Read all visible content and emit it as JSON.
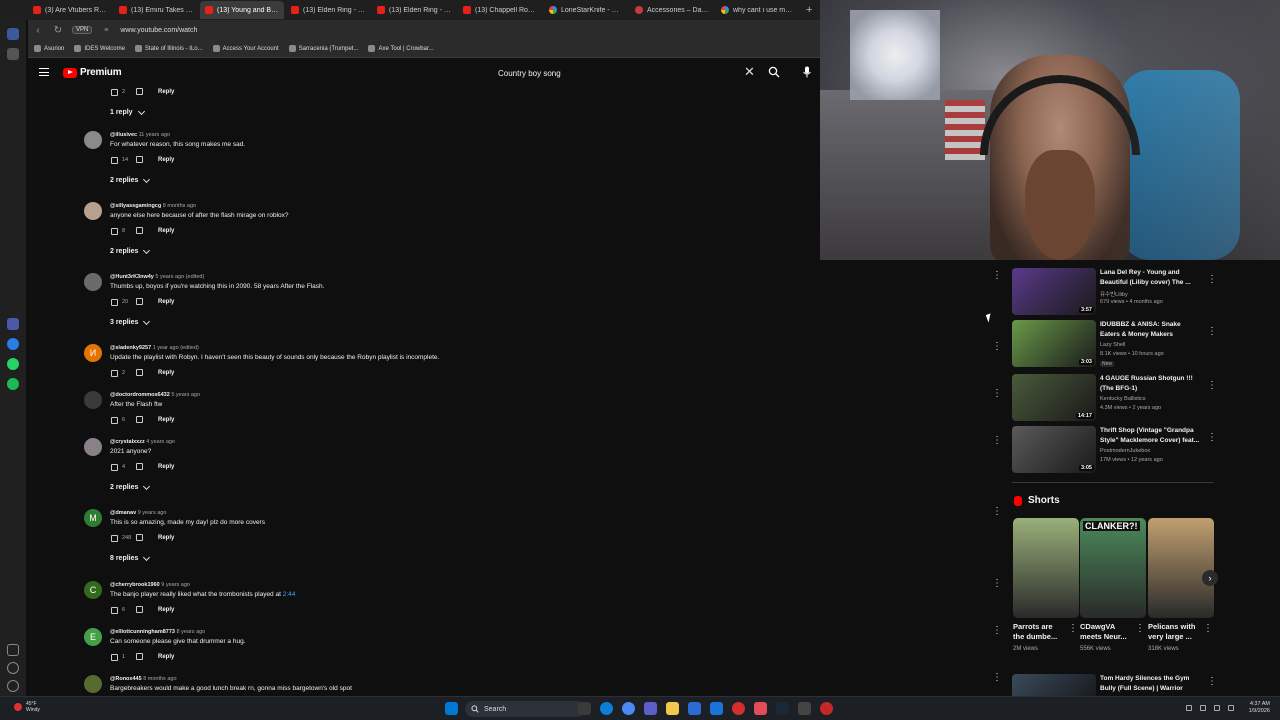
{
  "browser": {
    "tabs": [
      {
        "title": "(3) Are Vtubers Really th",
        "icon": "youtube-icon",
        "active": false
      },
      {
        "title": "(13) Emiru Takes Over As",
        "icon": "youtube-icon",
        "active": false
      },
      {
        "title": "(13) Young and Beautiful",
        "icon": "youtube-icon",
        "active": true
      },
      {
        "title": "(13) Elden Ring - Get These",
        "icon": "youtube-icon",
        "active": false
      },
      {
        "title": "(13) Elden Ring - Don't M",
        "icon": "youtube-icon",
        "active": false
      },
      {
        "title": "(13) Chappell Roan - Pink",
        "icon": "youtube-icon",
        "active": false
      },
      {
        "title": "LoneStarKnife - Google S",
        "icon": "google-icon",
        "active": false
      },
      {
        "title": "Accessories – Dart Armour",
        "icon": "site-icon",
        "active": false
      },
      {
        "title": "why cant i use my ashes i",
        "icon": "google-icon",
        "active": false
      }
    ],
    "new_tab": "+",
    "url": "www.youtube.com/watch",
    "vpn_label": "VPN",
    "bookmarks": [
      {
        "label": "Asurion"
      },
      {
        "label": "IDES Welcome"
      },
      {
        "label": "State of Illinois - ILo..."
      },
      {
        "label": "Access Your Account"
      },
      {
        "label": "Sarracenia (Trumpet..."
      },
      {
        "label": "Axe Tool | Crowbar..."
      }
    ]
  },
  "youtube": {
    "logo_text": "Premium",
    "search_value": "Country boy song",
    "clear_symbol": "✕"
  },
  "comments": {
    "top_partial": {
      "likes": "2",
      "reply": "Reply"
    },
    "first_toggle": "1 reply",
    "items": [
      {
        "author": "@illusivec",
        "time": "11 years ago",
        "text": "For whatever reason, this song makes me sad.",
        "likes": "14",
        "reply": "Reply",
        "toggle": "2 replies",
        "avatar_color": "#8a8a8a",
        "avatar_letter": ""
      },
      {
        "author": "@sillyassgamingcg",
        "time": "8 months ago",
        "text": "anyone else here because of after the flash mirage on roblox?",
        "likes": "8",
        "reply": "Reply",
        "toggle": "2 replies",
        "avatar_color": "#b8a090",
        "avatar_letter": ""
      },
      {
        "author": "@Hunt3rK3nw4y",
        "time": "5 years ago (edited)",
        "text": "Thumbs up, boyos if you're watching this in 2090. 58 years After the Flash.",
        "likes": "20",
        "reply": "Reply",
        "toggle": "3 replies",
        "avatar_color": "#6a6a6a",
        "avatar_letter": ""
      },
      {
        "author": "@sladenky9257",
        "time": "1 year ago (edited)",
        "text": "Update the playlist with Robyn. I haven't seen this beauty of sounds only because the Robyn playlist is incomplete.",
        "likes": "2",
        "reply": "Reply",
        "toggle": "",
        "avatar_color": "#e37400",
        "avatar_letter": "И"
      },
      {
        "author": "@doctordrommos6432",
        "time": "5 years ago",
        "text": "After the Flash ftw",
        "likes": "6",
        "reply": "Reply",
        "toggle": "",
        "avatar_color": "#3a3a3a",
        "avatar_letter": ""
      },
      {
        "author": "@crystalxxzz",
        "time": "4 years ago",
        "text": "2021 anyone?",
        "likes": "4",
        "reply": "Reply",
        "toggle": "2 replies",
        "avatar_color": "#8a8088",
        "avatar_letter": ""
      },
      {
        "author": "@dmanav",
        "time": "9 years ago",
        "text": "This is so amazing, made my day! plz do more covers",
        "likes": "248",
        "reply": "Reply",
        "toggle": "8 replies",
        "avatar_color": "#2e7d32",
        "avatar_letter": "M"
      },
      {
        "author": "@cherrybrook1960",
        "time": "9 years ago",
        "text": "The banjo player really liked what the trombonists played at ",
        "timestamp": "2:44",
        "likes": "6",
        "reply": "Reply",
        "toggle": "",
        "avatar_color": "#33691e",
        "avatar_letter": "C"
      },
      {
        "author": "@elliottcunningham8773",
        "time": "8 years ago",
        "text": "Can someone please give that drummer a hug.",
        "likes": "1",
        "reply": "Reply",
        "toggle": "",
        "avatar_color": "#43a047",
        "avatar_letter": "E"
      },
      {
        "author": "@Ronox445",
        "time": "8 months ago",
        "text": "Bargebreakers would make a good lunch break rn, gonna miss bargetown's old spot",
        "likes": "",
        "reply": "",
        "toggle": "",
        "avatar_color": "#556b2f",
        "avatar_letter": ""
      }
    ]
  },
  "recommendations": [
    {
      "title": "Lana Del Rey - Young and Beautiful (Liliby cover) The ...",
      "channel": "유수빈Liliby",
      "stats": "679 views • 4 months ago",
      "duration": "3:57",
      "badge": "",
      "thumb_color": "#5a3a8a"
    },
    {
      "title": "IDUBBBZ & ANISA: Snake Eaters & Money Makers",
      "channel": "Lazy Shell",
      "stats": "8.1K views • 10 hours ago",
      "duration": "3:03",
      "badge": "New",
      "thumb_color": "#6a9a4a"
    },
    {
      "title": "4 GAUGE Russian Shotgun !!! (The BFG-1)",
      "channel": "Kentucky Ballistics",
      "stats": "4.3M views • 2 years ago",
      "duration": "14:17",
      "badge": "",
      "thumb_color": "#4a5a3a"
    },
    {
      "title": "Thrift Shop (Vintage \"Grandpa Style\" Macklemore Cover) feat...",
      "channel": "PostmodernJukebox",
      "stats": "17M views • 12 years ago",
      "duration": "3:05",
      "badge": "",
      "thumb_color": "#5a5a5a"
    }
  ],
  "shorts": {
    "heading": "Shorts",
    "items": [
      {
        "title": "Parrots are the dumbe...",
        "views": "2M views",
        "thumb_color": "#9ab07a"
      },
      {
        "title": "CDawgVA meets Neur...",
        "views": "556K views",
        "thumb_color": "#4a8a5a"
      },
      {
        "title": "Pelicans with very large ...",
        "views": "318K views",
        "thumb_color": "#c0a070"
      }
    ],
    "thumb_overlay_text": "CLANKER?!",
    "next": "›"
  },
  "last_rec": {
    "title": "Tom Hardy Silences the Gym Bully (Full Scene) | Warrior",
    "thumb_color": "#3a4a5a"
  },
  "taskbar": {
    "weather_temp": "45°F",
    "weather_desc": "Windy",
    "search_label": "Search",
    "time": "4:37 AM",
    "date": "1/9/2026"
  }
}
